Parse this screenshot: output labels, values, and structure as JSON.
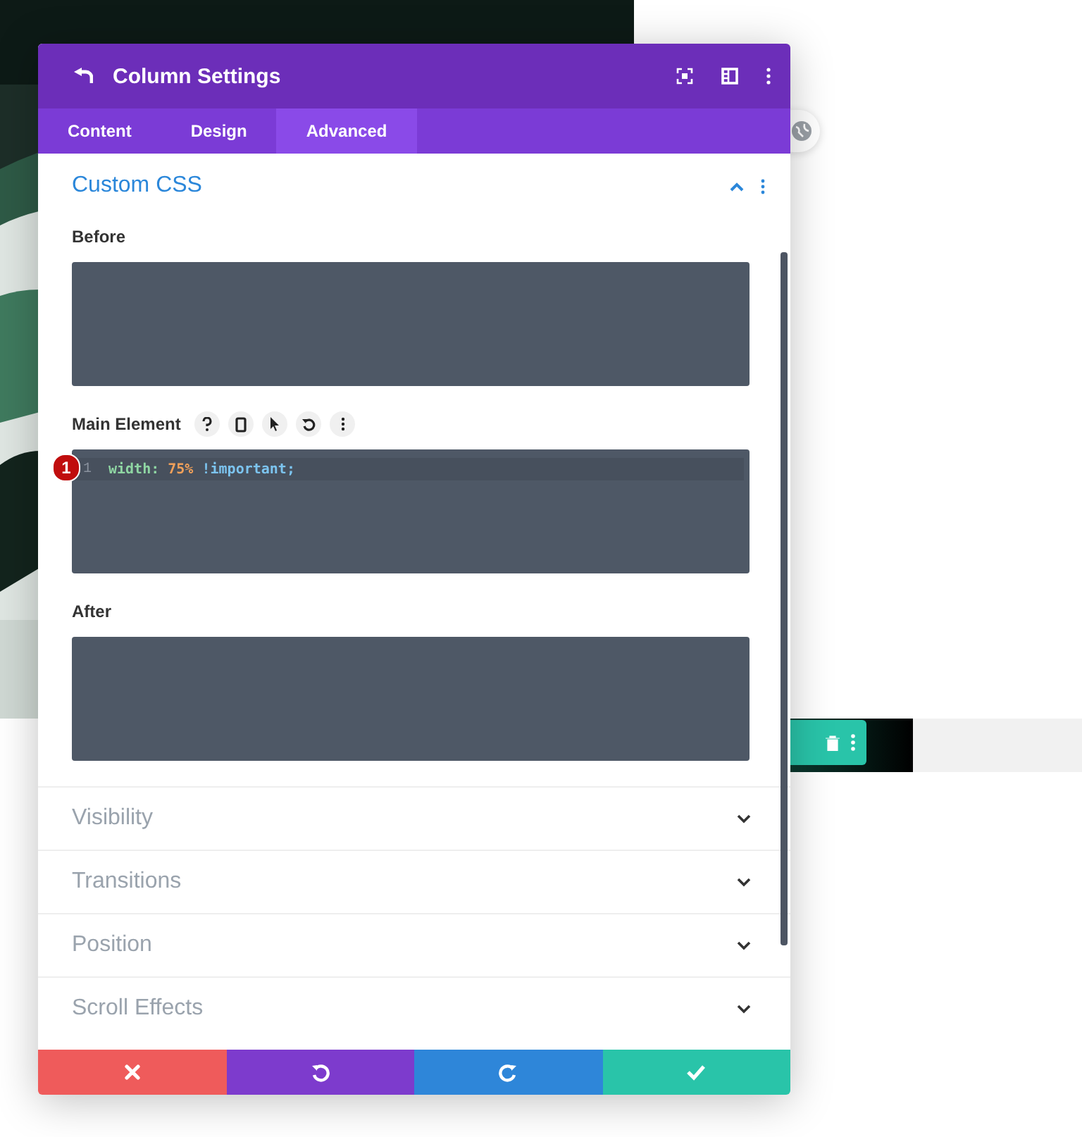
{
  "modal": {
    "title": "Column Settings",
    "tabs": [
      {
        "label": "Content",
        "selected": false
      },
      {
        "label": "Design",
        "selected": false
      },
      {
        "label": "Advanced",
        "selected": true
      }
    ],
    "section": {
      "title": "Custom CSS",
      "expanded": true,
      "fields": [
        {
          "label": "Before",
          "tools": false
        },
        {
          "label": "Main Element",
          "tools": true,
          "badge": "1",
          "lines": [
            {
              "number": "1",
              "tokens": [
                {
                  "kind": "property",
                  "text": "width:"
                },
                {
                  "kind": "number",
                  "text": "75%"
                },
                {
                  "kind": "keyword",
                  "text": "!important;"
                }
              ]
            }
          ]
        },
        {
          "label": "After",
          "tools": false
        }
      ]
    },
    "collapsed_sections": [
      {
        "title": "Visibility"
      },
      {
        "title": "Transitions"
      },
      {
        "title": "Position"
      },
      {
        "title": "Scroll Effects"
      }
    ],
    "footer": [
      {
        "kind": "cancel"
      },
      {
        "kind": "undo"
      },
      {
        "kind": "redo"
      },
      {
        "kind": "save"
      }
    ]
  }
}
